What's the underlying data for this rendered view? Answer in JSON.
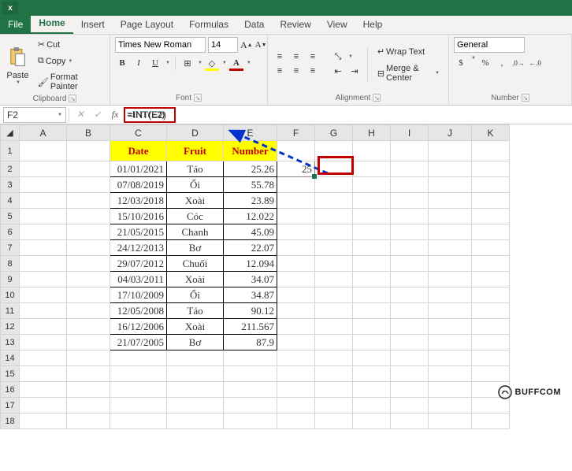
{
  "menu": {
    "file": "File",
    "home": "Home",
    "insert": "Insert",
    "page_layout": "Page Layout",
    "formulas": "Formulas",
    "data": "Data",
    "review": "Review",
    "view": "View",
    "help": "Help"
  },
  "ribbon": {
    "clipboard": {
      "paste": "Paste",
      "cut": "Cut",
      "copy": "Copy",
      "format_painter": "Format Painter",
      "label": "Clipboard"
    },
    "font": {
      "name": "Times New Roman",
      "size": "14",
      "bold": "B",
      "italic": "I",
      "underline": "U",
      "label": "Font",
      "color": "#c00000"
    },
    "alignment": {
      "wrap_text": "Wrap Text",
      "merge_center": "Merge & Center",
      "label": "Alignment"
    },
    "number": {
      "format": "General",
      "label": "Number"
    }
  },
  "namebox": "F2",
  "formula": "=INT(E2)",
  "columns": [
    "A",
    "B",
    "C",
    "D",
    "E",
    "F",
    "G",
    "H",
    "I",
    "J",
    "K"
  ],
  "headers": {
    "date": "Date",
    "fruit": "Fruit",
    "number": "Number"
  },
  "rows": [
    {
      "c": "01/01/2021",
      "d": "Táo",
      "e": "25.26",
      "f": "25"
    },
    {
      "c": "07/08/2019",
      "d": "Ổi",
      "e": "55.78"
    },
    {
      "c": "12/03/2018",
      "d": "Xoài",
      "e": "23.89"
    },
    {
      "c": "15/10/2016",
      "d": "Cóc",
      "e": "12.022"
    },
    {
      "c": "21/05/2015",
      "d": "Chanh",
      "e": "45.09"
    },
    {
      "c": "24/12/2013",
      "d": "Bơ",
      "e": "22.07"
    },
    {
      "c": "29/07/2012",
      "d": "Chuối",
      "e": "12.094"
    },
    {
      "c": "04/03/2011",
      "d": "Xoài",
      "e": "34.07"
    },
    {
      "c": "17/10/2009",
      "d": "Ổi",
      "e": "34.87"
    },
    {
      "c": "12/05/2008",
      "d": "Táo",
      "e": "90.12"
    },
    {
      "c": "16/12/2006",
      "d": "Xoài",
      "e": "211.567"
    },
    {
      "c": "21/07/2005",
      "d": "Bơ",
      "e": "87.9"
    }
  ],
  "watermark": "BUFFCOM"
}
